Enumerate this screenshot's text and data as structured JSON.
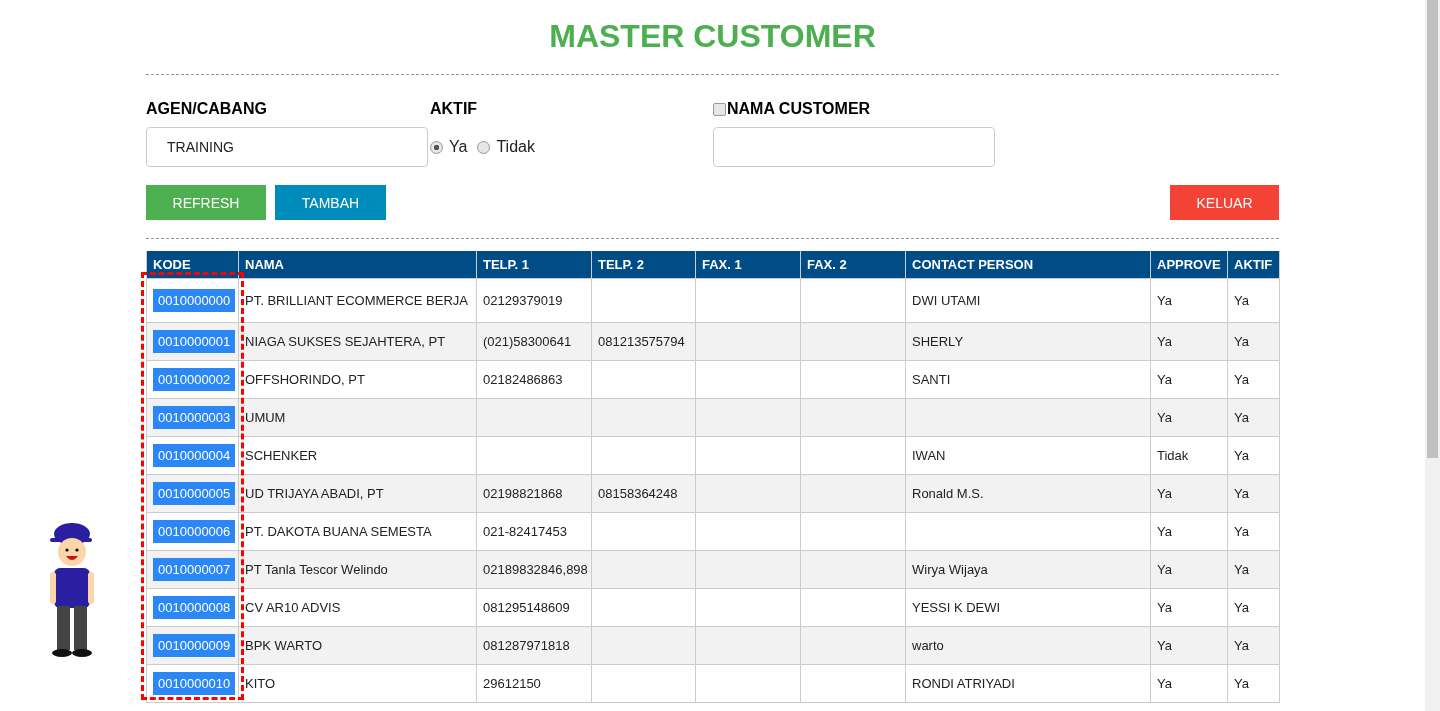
{
  "title": "MASTER CUSTOMER",
  "filters": {
    "agen": {
      "label": "AGEN/CABANG",
      "value": "TRAINING"
    },
    "aktif": {
      "label": "AKTIF",
      "options": [
        {
          "label": "Ya",
          "selected": true
        },
        {
          "label": "Tidak",
          "selected": false
        }
      ]
    },
    "nama": {
      "label": "NAMA CUSTOMER",
      "checked": false
    }
  },
  "buttons": [
    {
      "label": "REFRESH",
      "kind": "refresh"
    },
    {
      "label": "TAMBAH",
      "kind": "add"
    },
    {
      "label": "KELUAR",
      "kind": "exit"
    }
  ],
  "table": {
    "columns": [
      "KODE",
      "NAMA",
      "TELP. 1",
      "TELP. 2",
      "FAX. 1",
      "FAX. 2",
      "CONTACT PERSON",
      "APPROVE",
      "AKTIF"
    ],
    "rows": [
      {
        "cells": [
          "0010000000",
          "PT. BRILLIANT ECOMMERCE BERJA",
          "02129379019",
          "",
          "",
          "",
          "DWI UTAMI",
          "Ya",
          "Ya"
        ]
      },
      {
        "cells": [
          "0010000001",
          "NIAGA SUKSES SEJAHTERA, PT",
          "(021)58300641",
          "081213575794",
          "",
          "",
          "SHERLY",
          "Ya",
          "Ya"
        ]
      },
      {
        "cells": [
          "0010000002",
          "OFFSHORINDO, PT",
          "02182486863",
          "",
          "",
          "",
          "SANTI",
          "Ya",
          "Ya"
        ]
      },
      {
        "cells": [
          "0010000003",
          "UMUM",
          "",
          "",
          "",
          "",
          "",
          "Ya",
          "Ya"
        ]
      },
      {
        "cells": [
          "0010000004",
          "SCHENKER",
          "",
          "",
          "",
          "",
          "IWAN",
          "Tidak",
          "Ya"
        ]
      },
      {
        "cells": [
          "0010000005",
          "UD TRIJAYA ABADI, PT",
          "02198821868",
          "08158364248",
          "",
          "",
          "Ronald M.S.",
          "Ya",
          "Ya"
        ]
      },
      {
        "cells": [
          "0010000006",
          "PT. DAKOTA BUANA SEMESTA",
          "021-82417453",
          "",
          "",
          "",
          "",
          "Ya",
          "Ya"
        ]
      },
      {
        "cells": [
          "0010000007",
          "PT Tanla Tescor Welindo",
          "02189832846,898",
          "",
          "",
          "",
          "Wirya Wijaya",
          "Ya",
          "Ya"
        ]
      },
      {
        "cells": [
          "0010000008",
          "CV AR10 ADVIS",
          "081295148609",
          "",
          "",
          "",
          "YESSI K DEWI",
          "Ya",
          "Ya"
        ]
      },
      {
        "cells": [
          "0010000009",
          "BPK WARTO",
          "081287971818",
          "",
          "",
          "",
          "warto",
          "Ya",
          "Ya"
        ]
      },
      {
        "cells": [
          "0010000010",
          "KITO",
          "29612150",
          "",
          "",
          "",
          "RONDI ATRIYADI",
          "Ya",
          "Ya"
        ]
      }
    ]
  }
}
